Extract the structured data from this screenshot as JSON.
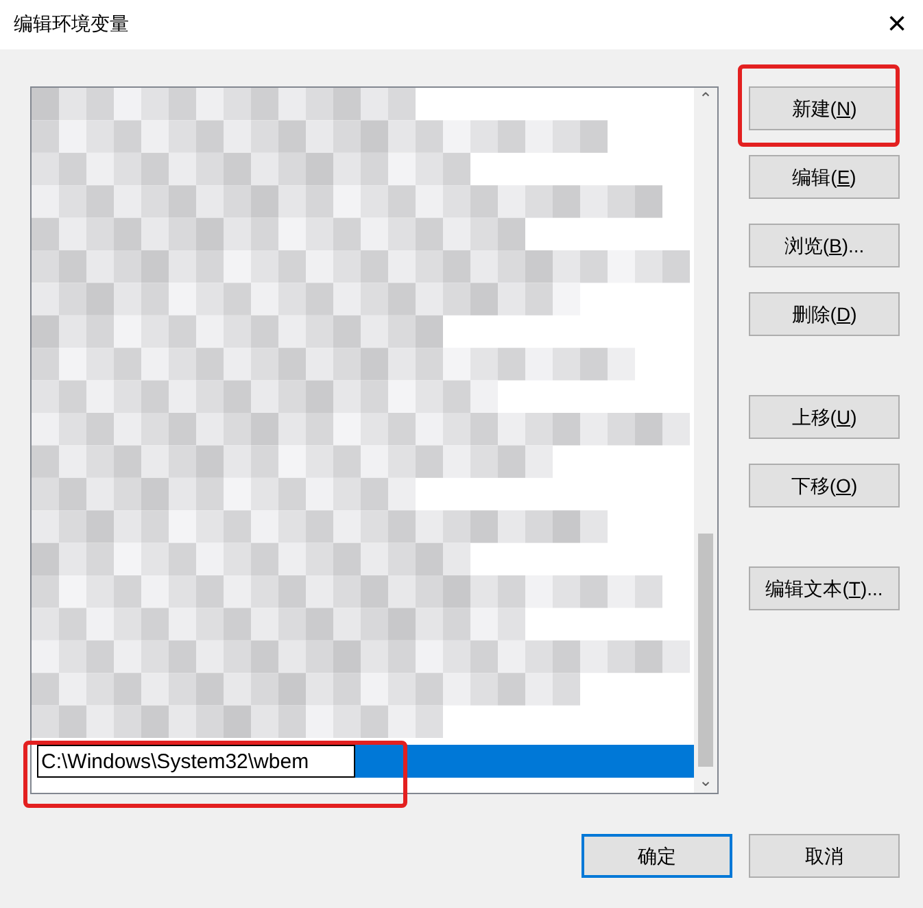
{
  "window": {
    "title": "编辑环境变量",
    "close": "×"
  },
  "list": {
    "editing_row": {
      "value": "C:\\Windows\\System32\\wbem",
      "selected": true,
      "highlighted": true
    },
    "scroll_up": "⌃",
    "scroll_down": "⌄"
  },
  "side_buttons": [
    {
      "prefix": "新建(",
      "accesskey": "N",
      "suffix": ")",
      "highlighted": true
    },
    {
      "prefix": "编辑(",
      "accesskey": "E",
      "suffix": ")",
      "highlighted": false
    },
    {
      "prefix": "浏览(",
      "accesskey": "B",
      "suffix": ")...",
      "highlighted": false
    },
    {
      "prefix": "删除(",
      "accesskey": "D",
      "suffix": ")",
      "highlighted": false
    },
    {
      "prefix": "上移(",
      "accesskey": "U",
      "suffix": ")",
      "highlighted": false
    },
    {
      "prefix": "下移(",
      "accesskey": "O",
      "suffix": ")",
      "highlighted": false
    },
    {
      "prefix": "编辑文本(",
      "accesskey": "T",
      "suffix": ")...",
      "highlighted": false
    }
  ],
  "footer_buttons": [
    {
      "label": "确定",
      "default": true
    },
    {
      "label": "取消",
      "default": false
    }
  ]
}
